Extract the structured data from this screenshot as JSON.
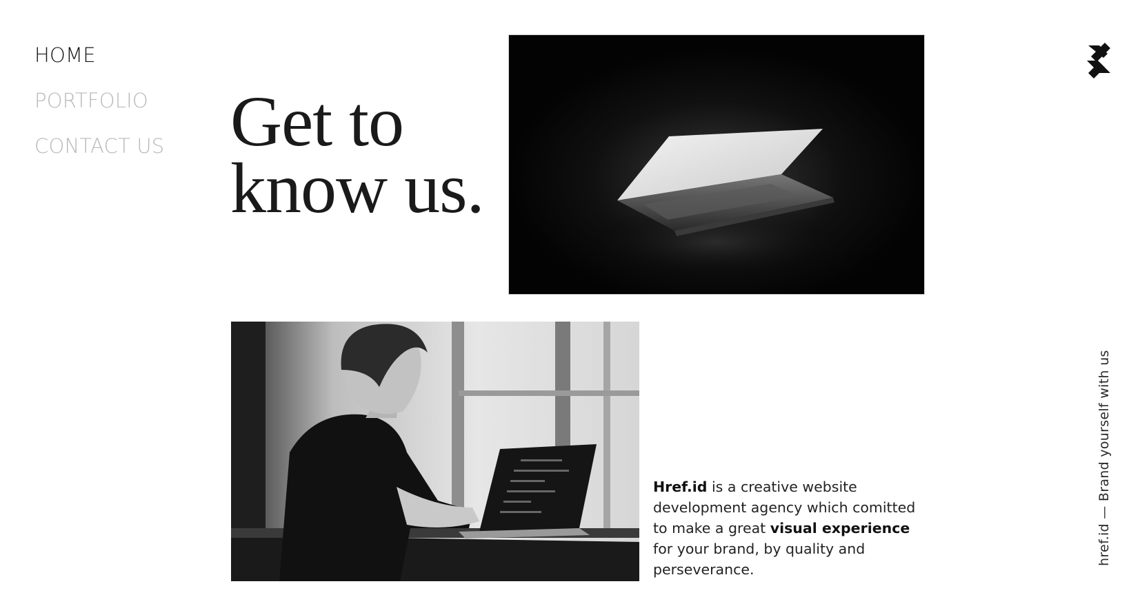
{
  "nav": {
    "items": [
      {
        "label": "HOME",
        "active": true
      },
      {
        "label": "PORTFOLIO",
        "active": false
      },
      {
        "label": "CONTACT US",
        "active": false
      }
    ]
  },
  "hero": {
    "heading_line1": "Get to",
    "heading_line2": "know us."
  },
  "about": {
    "brand": "Href.id",
    "text_part1": " is a creative website development agency which comitted to make a great ",
    "emphasis": "visual experience",
    "text_part2": " for your brand, by quality and perseverance."
  },
  "tagline": "href.id — Brand yourself with us",
  "logo": {
    "icon": "brand-logo-icon"
  },
  "images": {
    "top": "laptop-dark-photo",
    "bottom": "man-coding-photo"
  },
  "colors": {
    "nav_active": "#161616",
    "nav_inactive": "#b9b9b9",
    "text": "#222222"
  }
}
